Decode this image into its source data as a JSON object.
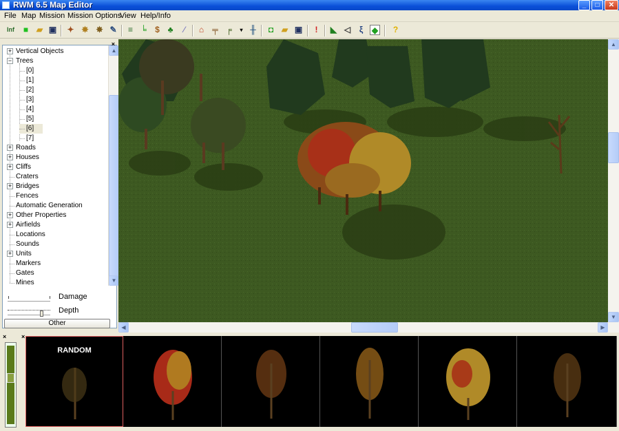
{
  "window": {
    "title": "RWM 6.5 Map Editor"
  },
  "menu": [
    "File",
    "Map",
    "Mission",
    "Mission Options",
    "View",
    "Help/Info"
  ],
  "toolbar_icons": [
    "info-icon",
    "new-icon",
    "open-icon",
    "save-icon",
    "unit-icon",
    "units-group-icon",
    "units-edit-icon",
    "edit-icon",
    "road-icon",
    "pipe-icon",
    "dollar-icon",
    "tree-icon",
    "brush-icon",
    "house-icon",
    "bench-icon",
    "bridge-icon",
    "dropdown-icon",
    "fence-icon",
    "script-new-icon",
    "script-open-icon",
    "script-save-icon",
    "alert-icon",
    "terrain-icon",
    "sound-icon",
    "animation-icon",
    "diamond-icon",
    "help-icon"
  ],
  "tree": {
    "items": [
      {
        "label": "Vertical Objects",
        "expander": "+"
      },
      {
        "label": "Trees",
        "expander": "−"
      },
      {
        "label": "[0]"
      },
      {
        "label": "[1]"
      },
      {
        "label": "[2]"
      },
      {
        "label": "[3]"
      },
      {
        "label": "[4]"
      },
      {
        "label": "[5]"
      },
      {
        "label": "[6]"
      },
      {
        "label": "[7]"
      },
      {
        "label": "Roads",
        "expander": "+"
      },
      {
        "label": "Houses",
        "expander": "+"
      },
      {
        "label": "Cliffs",
        "expander": "+"
      },
      {
        "label": "Craters"
      },
      {
        "label": "Bridges",
        "expander": "+"
      },
      {
        "label": "Fences"
      },
      {
        "label": "Automatic Generation"
      },
      {
        "label": "Other Properties",
        "expander": "+"
      },
      {
        "label": "Airfields",
        "expander": "+"
      },
      {
        "label": "Locations"
      },
      {
        "label": "Sounds"
      },
      {
        "label": "Units",
        "expander": "+"
      },
      {
        "label": "Markers"
      },
      {
        "label": "Gates"
      },
      {
        "label": "Mines"
      }
    ]
  },
  "sliders": {
    "damage_label": "Damage",
    "depth_label": "Depth"
  },
  "other_button": "Other",
  "palette": {
    "first_label": "RANDOM"
  },
  "colors": {
    "title_blue": "#0a4fd8",
    "selection_border": "#e06060",
    "grass": "#3f5a22"
  }
}
